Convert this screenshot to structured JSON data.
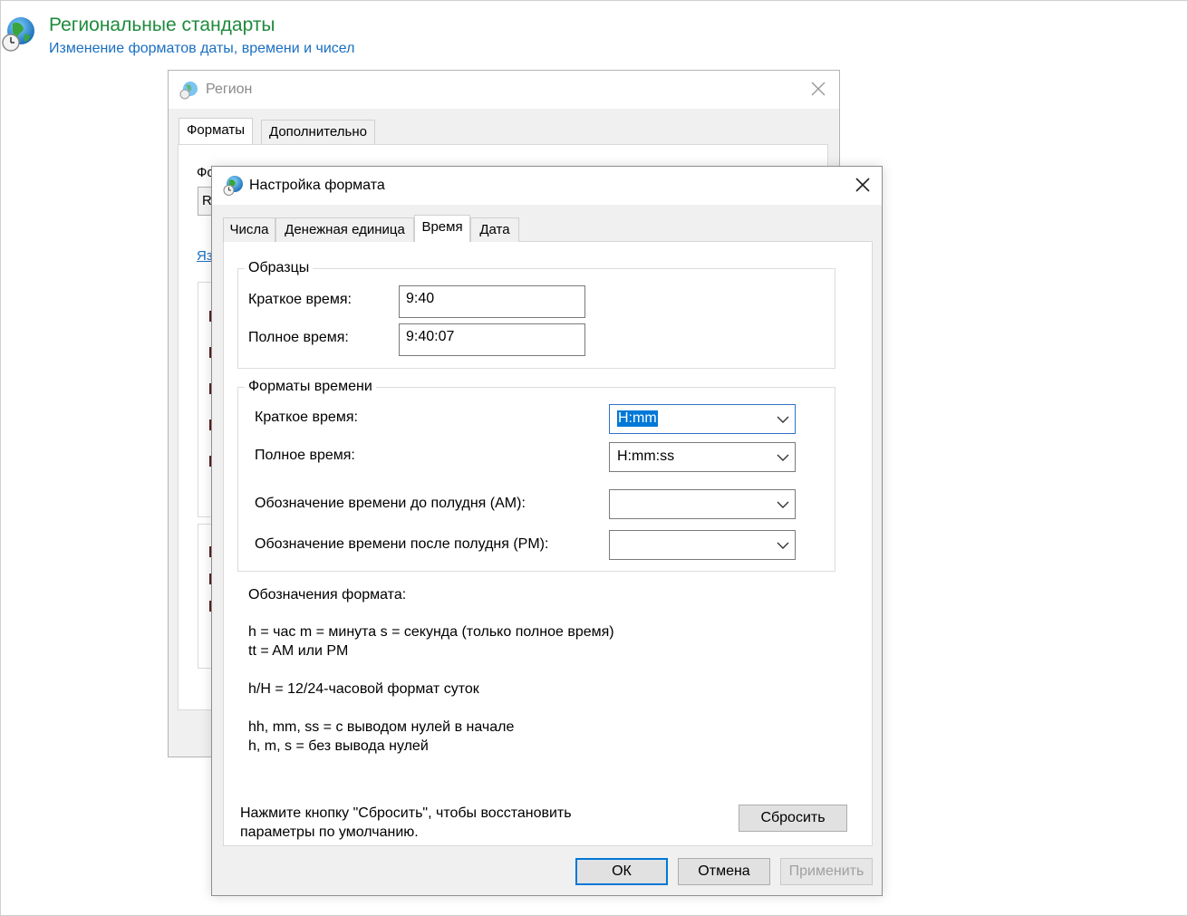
{
  "header": {
    "title": "Региональные стандарты",
    "subtitle": "Изменение форматов даты, времени и чисел",
    "icon": "globe-clock-icon"
  },
  "region_window": {
    "title": "Регион",
    "tabs": [
      {
        "label": "Форматы",
        "active": true
      },
      {
        "label": "Дополнительно",
        "active": false
      }
    ],
    "peek_label": "Фо",
    "peek_box": "R",
    "peek_link": "Яз"
  },
  "dialog": {
    "title": "Настройка формата",
    "tabs": [
      {
        "label": "Числа",
        "active": false
      },
      {
        "label": "Денежная единица",
        "active": false
      },
      {
        "label": "Время",
        "active": true
      },
      {
        "label": "Дата",
        "active": false
      }
    ],
    "samples": {
      "legend": "Образцы",
      "short_label": "Краткое время:",
      "short_value": "9:40",
      "long_label": "Полное время:",
      "long_value": "9:40:07"
    },
    "formats": {
      "legend": "Форматы времени",
      "short_label": "Краткое время:",
      "short_value": "H:mm",
      "long_label": "Полное время:",
      "long_value": "H:mm:ss",
      "am_label": "Обозначение времени до полудня (AM):",
      "am_value": "",
      "pm_label": "Обозначение времени после полудня (PM):",
      "pm_value": ""
    },
    "notation": {
      "heading": "Обозначения формата:",
      "line1": "h = час   m = минута   s = секунда (только полное время)",
      "line2": "tt = AM или PM",
      "line3": "h/H = 12/24-часовой формат суток",
      "line4": "hh, mm, ss = с выводом нулей в начале",
      "line5": "h, m, s = без вывода нулей"
    },
    "reset": {
      "hint_line1": "Нажмите кнопку \"Сбросить\", чтобы восстановить",
      "hint_line2": "параметры по умолчанию.",
      "button": "Сбросить"
    },
    "buttons": {
      "ok": "ОК",
      "cancel": "Отмена",
      "apply": "Применить"
    }
  },
  "colors": {
    "header_title": "#1e8a3c",
    "header_link": "#1a6fc0",
    "selection": "#0078d7"
  }
}
